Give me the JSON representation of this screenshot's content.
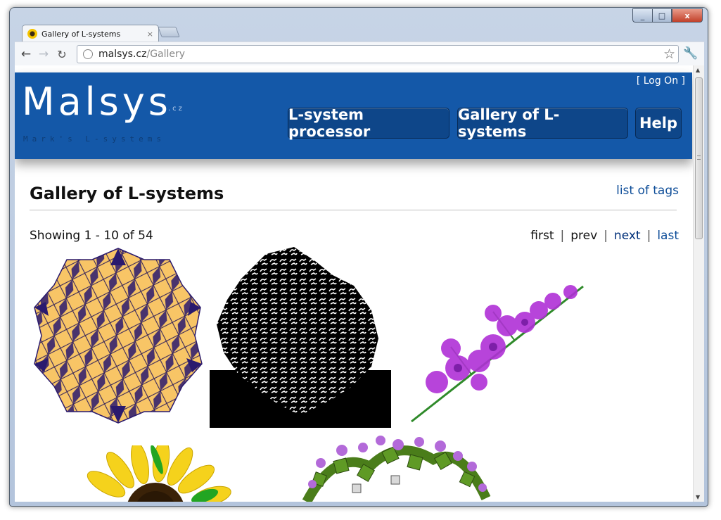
{
  "browser": {
    "tab_title": "Gallery of L-systems",
    "tab_close": "×",
    "url_domain": "malsys.cz",
    "url_path": "/Gallery",
    "window_controls": {
      "minimize": "_",
      "maximize": "□",
      "close": "x"
    }
  },
  "site": {
    "logo": "Malsys",
    "logo_suffix": ".cz",
    "tagline": "Mark's L-systems",
    "login": "[ Log On ]",
    "nav": {
      "processor": "L-system processor",
      "gallery": "Gallery of L-systems",
      "help": "Help"
    },
    "colors": {
      "header": "#1458a8",
      "nav_button": "#0e4689",
      "link": "#0f4e99"
    }
  },
  "page": {
    "title": "Gallery of L-systems",
    "tags_link": "list of tags",
    "showing": "Showing 1 - 10 of 54",
    "pager": {
      "first": "first",
      "prev": "prev",
      "next": "next",
      "last": "last",
      "separator": "|"
    }
  },
  "gallery": [
    {
      "icon": "penrose-tiling-thumbnail"
    },
    {
      "icon": "dragon-curve-tiling-thumbnail"
    },
    {
      "icon": "purple-flower-branch-thumbnail"
    },
    {
      "icon": "sunflower-thumbnail"
    },
    {
      "icon": "fractal-garden-thumbnail"
    }
  ]
}
